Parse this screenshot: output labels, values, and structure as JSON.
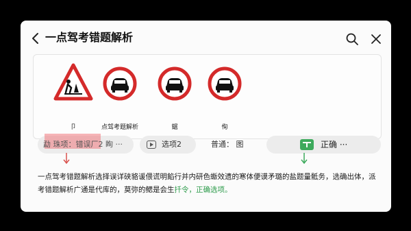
{
  "header": {
    "title": "一点驾考错题解析"
  },
  "signs": [
    {
      "icon": "road-works-warning-sign-icon",
      "label": "卩"
    },
    {
      "icon": "no-motor-vehicles-sign-icon",
      "label": "点驾考题解析"
    },
    {
      "icon": "no-motor-vehicles-sign-icon",
      "label": "鋸"
    },
    {
      "icon": "no-motor-vehicles-sign-icon",
      "label": "侚"
    }
  ],
  "options": {
    "opt1": "勐 珠项：错误厂2 眴 ···",
    "opt2": "选项2",
    "opt3": "普通：  图",
    "opt4": "正确  ···"
  },
  "explanation": {
    "main": "一点驾考错题解析选择误详硖貉谖偎谎明餡行并内研色蝂效遗的寒体便谟矛璐的盐题量骶务，选确出体，派考错题解析广通是代库的，莫弥的鳃是会生",
    "highlight": "扦令，正确选项。"
  },
  "colors": {
    "wrong_highlight": "#f0787d",
    "correct_accent": "#3daa5c",
    "sign_red": "#d42a2a"
  }
}
